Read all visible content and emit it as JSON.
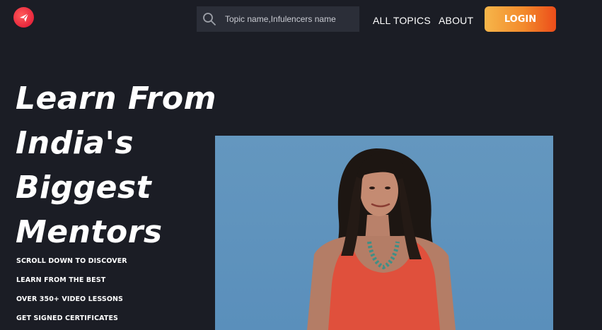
{
  "header": {
    "logo_icon": "paper-plane-icon",
    "search": {
      "placeholder": "Topic name,Infulencers name",
      "icon": "search-icon"
    },
    "nav": [
      {
        "label": "ALL TOPICS"
      },
      {
        "label": "ABOUT"
      }
    ],
    "login_label": "LOGIN"
  },
  "hero": {
    "title_lines": [
      "Learn From",
      "India's",
      "Biggest",
      "Mentors"
    ],
    "features": [
      "SCROLL DOWN TO DISCOVER",
      "LEARN FROM THE BEST",
      "OVER 350+ VIDEO LESSONS",
      "GET SIGNED CERTIFICATES"
    ]
  },
  "colors": {
    "background": "#1b1d25",
    "search_bg": "#2b2e38",
    "login_gradient_start": "#f6b64a",
    "login_gradient_end": "#ec4d1a",
    "logo": "#e8273c",
    "video_bg": "#5f93bd"
  }
}
